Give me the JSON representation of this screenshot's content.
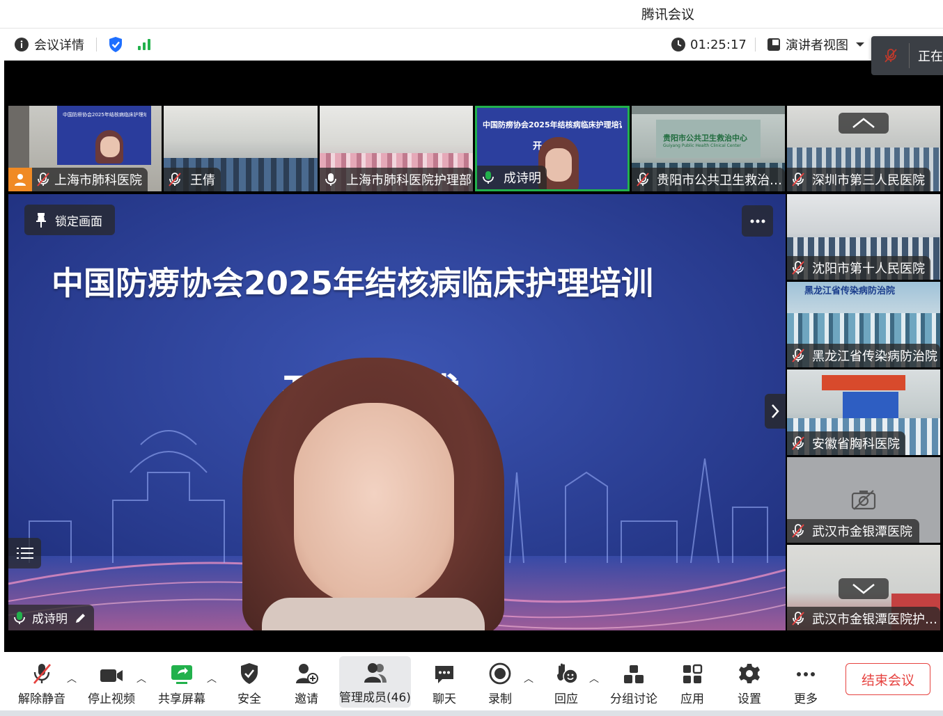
{
  "app_title": "腾讯会议",
  "infobar": {
    "meeting_details": "会议详情",
    "timer": "01:25:17",
    "view_mode": "演讲者视图",
    "speaking_prefix": "正在"
  },
  "thumbnails": [
    {
      "name": "上海市肺科医院"
    },
    {
      "name": "王倩"
    },
    {
      "name": "上海市肺科医院护理部"
    },
    {
      "name": "成诗明"
    },
    {
      "name": "贵阳市公共卫生救治…"
    },
    {
      "name": "深圳市第三人民医院"
    }
  ],
  "sidebar": [
    {
      "name": "沈阳市第十人民医院"
    },
    {
      "name": "黑龙江省传染病防治院"
    },
    {
      "name": "安徽省胸科医院"
    },
    {
      "name": "武汉市金银潭医院"
    },
    {
      "name": "武汉市金银潭医院护…"
    }
  ],
  "main_video": {
    "lock_label": "锁定画面",
    "slide_title": "中国防痨协会2025年结核病临床护理培训",
    "slide_subtitle_partial": "开  式",
    "thumb_slide_title": "中国防痨协会2025年结核病临床护理培训",
    "thumb_slide_sub": "开  式",
    "board_text": "中国防痨协会2025年结核病临床护理培训",
    "sign_text": "贵阳市公共卫生救治中心",
    "sign_text_en": "Guiyang Public Health Clinical Center",
    "banner_text": "黑龙江省传染病防治院",
    "speaker_name": "成诗明"
  },
  "toolbar": {
    "unmute": "解除静音",
    "stop_video": "停止视频",
    "share_screen": "共享屏幕",
    "security": "安全",
    "invite": "邀请",
    "manage_members": "管理成员(46)",
    "chat": "聊天",
    "record": "录制",
    "reactions": "回应",
    "breakout": "分组讨论",
    "apps": "应用",
    "settings": "设置",
    "more": "更多",
    "end_meeting": "结束会议"
  },
  "colors": {
    "accent_green": "#22b14c",
    "shield_blue": "#1e6fff",
    "end_red": "#e64340",
    "slide_blue": "#273a8f",
    "mic_muted_red": "#e64340"
  }
}
